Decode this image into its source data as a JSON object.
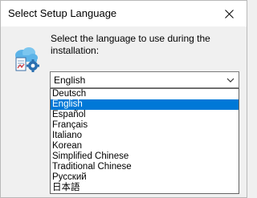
{
  "window": {
    "title": "Select Setup Language"
  },
  "prompt": "Select the language to use during the installation:",
  "combo": {
    "value": "English"
  },
  "dropdown": {
    "options": [
      "Deutsch",
      "English",
      "Español",
      "Français",
      "Italiano",
      "Korean",
      "Simplified Chinese",
      "Traditional Chinese",
      "Русский",
      "日本語"
    ],
    "selected_index": 1
  },
  "colors": {
    "selection": "#0078d7",
    "icon_cloud": "#5db4e8",
    "icon_gear": "#2a6fb0"
  },
  "icons": {
    "close": "close-icon",
    "app": "setup-app-icon",
    "arrow": "chevron-down-icon"
  }
}
